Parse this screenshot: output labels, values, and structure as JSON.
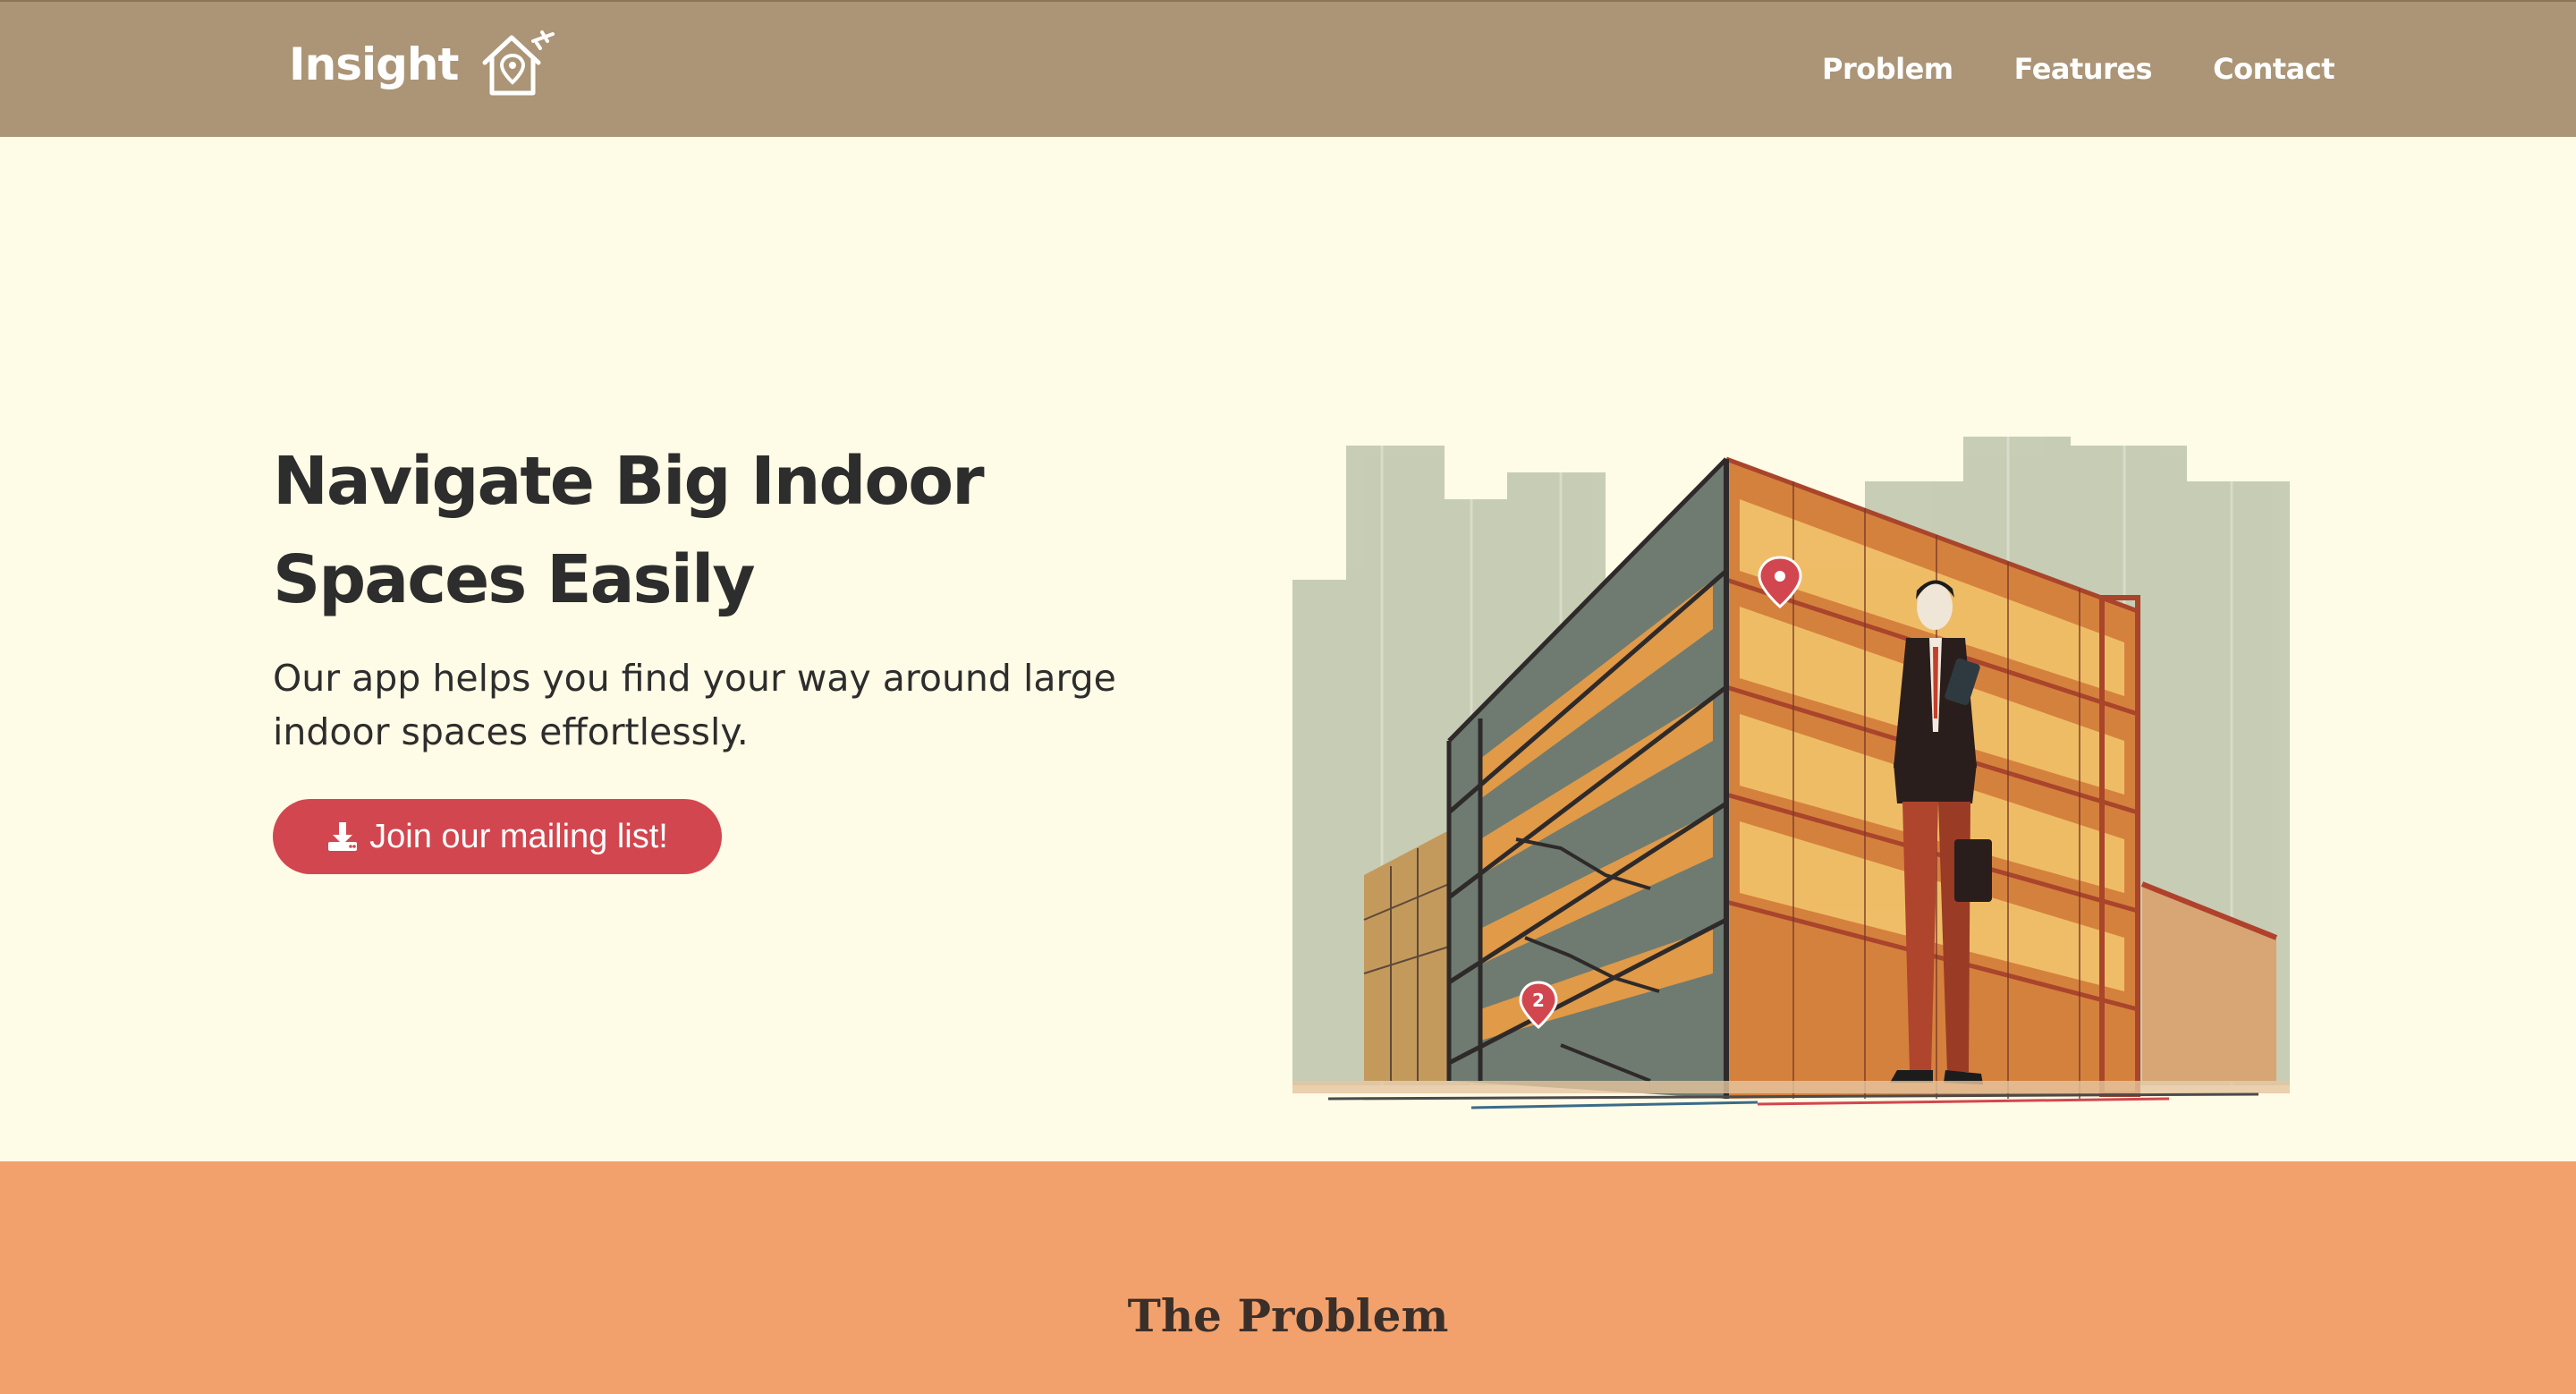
{
  "nav": {
    "brand": "Insight",
    "brand_icon": "house-location-pin-icon",
    "links": [
      {
        "label": "Problem"
      },
      {
        "label": "Features"
      },
      {
        "label": "Contact"
      }
    ]
  },
  "hero": {
    "title": "Navigate Big Indoor Spaces Easily",
    "text": "Our app helps you find your way around large indoor spaces effortlessly.",
    "cta_label": "Join our mailing list!",
    "cta_icon": "download-icon",
    "image": "building-illustration"
  },
  "problem": {
    "title": "The Problem"
  },
  "colors": {
    "nav_bg": "#ab9576",
    "hero_bg": "#fefbe6",
    "cta_bg": "#d2474f",
    "problem_bg": "#f2a16c",
    "text": "#2d2d2d"
  }
}
